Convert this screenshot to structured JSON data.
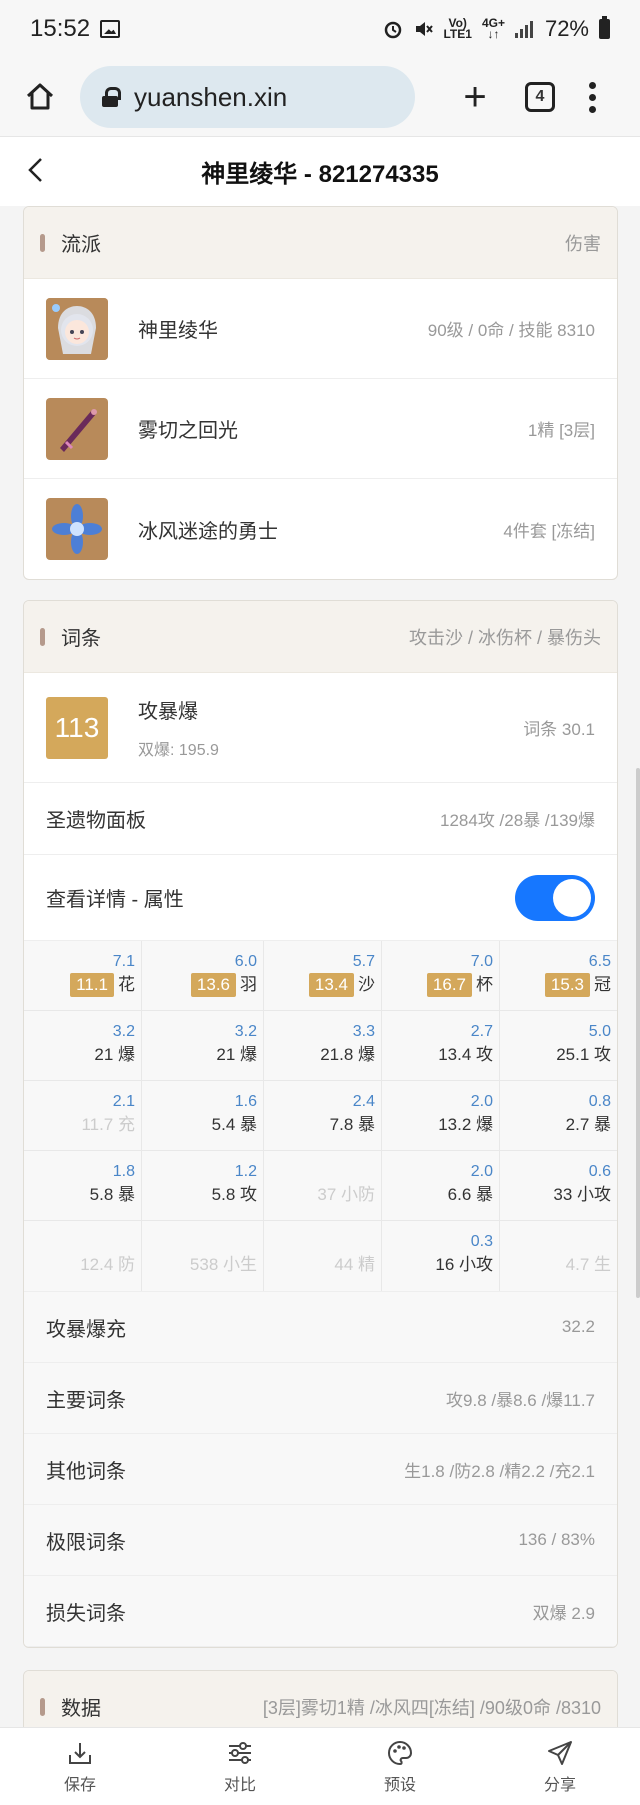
{
  "status": {
    "time": "15:52",
    "net1": "Vo)",
    "net2": "LTE1",
    "net3": "4G+",
    "battery": "72%"
  },
  "browser": {
    "url": "yuanshen.xin",
    "tab_count": "4"
  },
  "header": {
    "title": "神里绫华 - 821274335"
  },
  "build_card": {
    "title": "流派",
    "extra": "伤害",
    "items": [
      {
        "name": "神里绫华",
        "info": "90级 / 0命 / 技能 8310"
      },
      {
        "name": "雾切之回光",
        "info": "1精 [3层]"
      },
      {
        "name": "冰风迷途的勇士",
        "info": "4件套 [冻结]"
      }
    ]
  },
  "stats_card": {
    "title": "词条",
    "extra": "攻击沙 / 冰伤杯 / 暴伤头",
    "score": "113",
    "score_name": "攻暴爆",
    "score_sub": "双爆: 195.9",
    "score_info": "词条 30.1",
    "panel_label": "圣遗物面板",
    "panel_value": "1284攻 /28暴 /139爆",
    "detail_label": "查看详情 - 属性",
    "grid": [
      [
        {
          "top": "7.1",
          "badge": "11.1",
          "main": "花",
          "faded": false
        },
        {
          "top": "6.0",
          "badge": "13.6",
          "main": "羽",
          "faded": false
        },
        {
          "top": "5.7",
          "badge": "13.4",
          "main": "沙",
          "faded": false
        },
        {
          "top": "7.0",
          "badge": "16.7",
          "main": "杯",
          "faded": false
        },
        {
          "top": "6.5",
          "badge": "15.3",
          "main": "冠",
          "faded": false
        }
      ],
      [
        {
          "top": "3.2",
          "main": "21 爆",
          "faded": false
        },
        {
          "top": "3.2",
          "main": "21 爆",
          "faded": false
        },
        {
          "top": "3.3",
          "main": "21.8 爆",
          "faded": false
        },
        {
          "top": "2.7",
          "main": "13.4 攻",
          "faded": false
        },
        {
          "top": "5.0",
          "main": "25.1 攻",
          "faded": false
        }
      ],
      [
        {
          "top": "2.1",
          "main": "11.7 充",
          "faded": true
        },
        {
          "top": "1.6",
          "main": "5.4 暴",
          "faded": false
        },
        {
          "top": "2.4",
          "main": "7.8 暴",
          "faded": false
        },
        {
          "top": "2.0",
          "main": "13.2 爆",
          "faded": false
        },
        {
          "top": "0.8",
          "main": "2.7 暴",
          "faded": false
        }
      ],
      [
        {
          "top": "1.8",
          "main": "5.8 暴",
          "faded": false
        },
        {
          "top": "1.2",
          "main": "5.8 攻",
          "faded": false
        },
        {
          "top": "",
          "main": "37 小防",
          "faded": true
        },
        {
          "top": "2.0",
          "main": "6.6 暴",
          "faded": false
        },
        {
          "top": "0.6",
          "main": "33 小攻",
          "faded": false
        }
      ],
      [
        {
          "top": "",
          "main": "12.4 防",
          "faded": true
        },
        {
          "top": "",
          "main": "538 小生",
          "faded": true
        },
        {
          "top": "",
          "main": "44 精",
          "faded": true
        },
        {
          "top": "0.3",
          "main": "16 小攻",
          "faded": false
        },
        {
          "top": "",
          "main": "4.7 生",
          "faded": true
        }
      ]
    ],
    "summary": [
      {
        "label": "攻暴爆充",
        "value": "32.2"
      },
      {
        "label": "主要词条",
        "value": "攻9.8 /暴8.6 /爆11.7"
      },
      {
        "label": "其他词条",
        "value": "生1.8 /防2.8 /精2.2 /充2.1"
      },
      {
        "label": "极限词条",
        "value": "136 / 83%"
      },
      {
        "label": "损失词条",
        "value": "双爆 2.9"
      }
    ]
  },
  "data_card": {
    "title": "数据",
    "extra": "[3层]雾切1精 /冰风四[冻结] /90级0命 /8310"
  },
  "bottom_nav": [
    {
      "label": "保存",
      "icon": "save-icon"
    },
    {
      "label": "对比",
      "icon": "compare-icon"
    },
    {
      "label": "预设",
      "icon": "palette-icon"
    },
    {
      "label": "分享",
      "icon": "share-icon"
    }
  ],
  "colors": {
    "accent": "#1677ff",
    "gold": "#d4a85b",
    "blue_value": "#4a86c8"
  }
}
